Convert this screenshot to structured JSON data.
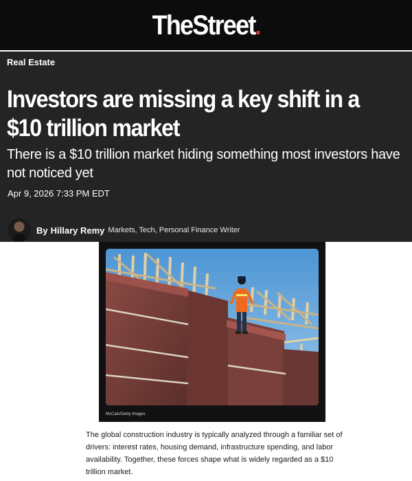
{
  "header": {
    "logo_text": "TheStreet",
    "background_color": "#0c0c0c",
    "accent_color": "#e5322d"
  },
  "article": {
    "section": "Real Estate",
    "headline": "Investors are missing a key shift in a $10 trillion market",
    "subheadline": "There is a $10 trillion market hiding something most investors have not noticed yet",
    "date": "Apr 9, 2026 7:33 PM EDT",
    "byline": {
      "prefix": "By",
      "author": "Hillary Remy",
      "role": "Markets, Tech, Personal Finance Writer",
      "avatar_icon": "author-avatar"
    },
    "image": {
      "subject": "construction-worker-on-building-frame",
      "credit": "McCain/Getty Images"
    },
    "body_paragraph": "The global construction industry is typically analyzed through a familiar set of drivers: interest rates, housing demand, infrastructure spending, and labor availability. Together, these forces shape what is widely regarded as a $10 trillion market."
  },
  "colors": {
    "hero_background": "#242424",
    "text_light": "#ffffff",
    "body_text": "#1a1a1a"
  }
}
